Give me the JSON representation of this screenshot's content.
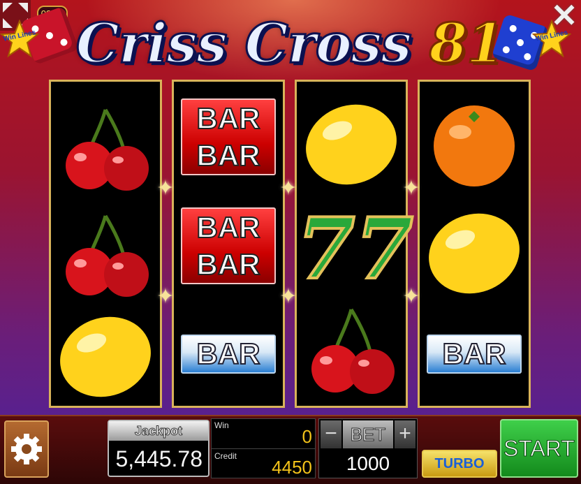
{
  "header": {
    "clock": "08:46",
    "title_words": "Criss Cross",
    "title_number": "81",
    "badge_text": "Win Lines",
    "close_symbol": "✕"
  },
  "reels": [
    {
      "name": "reel-1",
      "symbols": [
        "cherry",
        "cherry",
        "lemon"
      ]
    },
    {
      "name": "reel-2",
      "symbols": [
        "double-bar",
        "double-bar",
        "single-bar"
      ]
    },
    {
      "name": "reel-3",
      "symbols": [
        "lemon",
        "seven",
        "cherry"
      ]
    },
    {
      "name": "reel-4",
      "symbols": [
        "orange",
        "lemon",
        "single-bar"
      ]
    }
  ],
  "bar_text": "BAR",
  "seven_text": "77",
  "panel": {
    "jackpot_label": "Jackpot",
    "jackpot_value": "5,445.78",
    "win_label": "Win",
    "win_value": "0",
    "credit_label": "Credit",
    "credit_value": "4450",
    "bet_label": "BET",
    "bet_minus": "−",
    "bet_plus": "+",
    "bet_value": "1000",
    "turbo_label": "TURBO",
    "start_label": "START"
  },
  "colors": {
    "frame_gold": "#d9b35a",
    "start_green": "#2db837",
    "credit_yellow": "#f2c21a"
  }
}
